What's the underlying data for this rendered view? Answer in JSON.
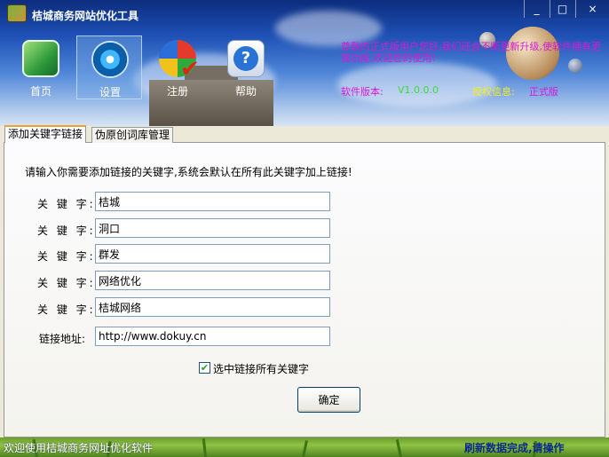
{
  "window": {
    "title": "桔城商务网站优化工具",
    "controls": {
      "minimize": "_",
      "maximize": "□",
      "close": "×"
    }
  },
  "nav": {
    "items": [
      {
        "label": "首页",
        "icon": "home-icon"
      },
      {
        "label": "设置",
        "icon": "settings-disc-icon"
      },
      {
        "label": "注册",
        "icon": "register-check-icon"
      },
      {
        "label": "帮助",
        "icon": "help-icon"
      }
    ],
    "active": "设置"
  },
  "header": {
    "welcome": "尊敬的正式版用户您好,我们还会不断更新升级,使软件拥有更强功能,欢迎您的使用!",
    "version_label": "软件版本:",
    "version_value": "V1.0.0.0",
    "license_label": "授权信息:",
    "license_value": "正式版"
  },
  "tabs": [
    {
      "label": "添加关键字链接",
      "active": true
    },
    {
      "label": "伪原创词库管理",
      "active": false
    }
  ],
  "form": {
    "instruction": "请输入你需要添加链接的关键字,系统会默认在所有此关键字加上链接!",
    "keyword_label": "关 键 字:",
    "keywords": [
      "桔城",
      "洞口",
      "群发",
      "网络优化",
      "桔城网络"
    ],
    "url_label": "链接地址:",
    "url_value": "http://www.dokuy.cn",
    "checkbox_label": "选中链接所有关键字",
    "checkbox_checked": true,
    "confirm_label": "确定"
  },
  "statusbar": {
    "left": "欢迎使用桔城商务网址优化软件",
    "right": "刷新数据完成,请操作"
  },
  "colors": {
    "magenta_text": "#d818d8",
    "version_green": "#3cd83c",
    "license_yellow": "#f2ee22",
    "tab_accent": "#f1a12e"
  }
}
